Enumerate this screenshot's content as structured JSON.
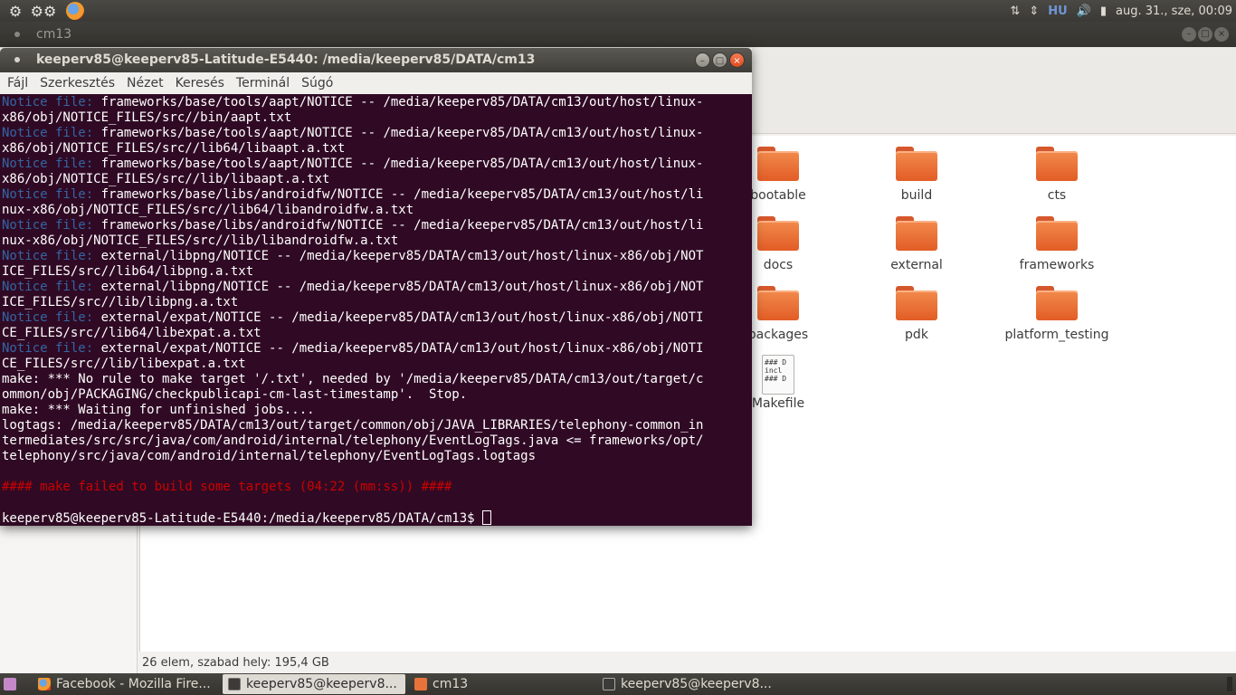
{
  "top_panel": {
    "keyboard_layout": "HU",
    "clock": "aug. 31., sze, 00:09"
  },
  "file_manager": {
    "title": "cm13",
    "status": "26 elem, szabad hely: 195,4 GB",
    "items": [
      {
        "name": "bootable",
        "type": "folder"
      },
      {
        "name": "build",
        "type": "folder"
      },
      {
        "name": "cts",
        "type": "folder"
      },
      {
        "name": "docs",
        "type": "folder"
      },
      {
        "name": "external",
        "type": "folder"
      },
      {
        "name": "frameworks",
        "type": "folder"
      },
      {
        "name": "packages",
        "type": "folder"
      },
      {
        "name": "pdk",
        "type": "folder"
      },
      {
        "name": "platform_testing",
        "type": "folder"
      },
      {
        "name": "Makefile",
        "type": "file",
        "preview": "### D\nincl\n### D"
      }
    ]
  },
  "terminal": {
    "title": "keeperv85@keeperv85-Latitude-E5440: /media/keeperv85/DATA/cm13",
    "menu": [
      "Fájl",
      "Szerkesztés",
      "Nézet",
      "Keresés",
      "Terminál",
      "Súgó"
    ],
    "lines": [
      {
        "prefix": "Notice file:",
        "text": " frameworks/base/tools/aapt/NOTICE -- /media/keeperv85/DATA/cm13/out/host/linux-"
      },
      {
        "prefix": "",
        "text": "x86/obj/NOTICE_FILES/src//bin/aapt.txt"
      },
      {
        "prefix": "Notice file:",
        "text": " frameworks/base/tools/aapt/NOTICE -- /media/keeperv85/DATA/cm13/out/host/linux-"
      },
      {
        "prefix": "",
        "text": "x86/obj/NOTICE_FILES/src//lib64/libaapt.a.txt"
      },
      {
        "prefix": "Notice file:",
        "text": " frameworks/base/tools/aapt/NOTICE -- /media/keeperv85/DATA/cm13/out/host/linux-"
      },
      {
        "prefix": "",
        "text": "x86/obj/NOTICE_FILES/src//lib/libaapt.a.txt"
      },
      {
        "prefix": "Notice file:",
        "text": " frameworks/base/libs/androidfw/NOTICE -- /media/keeperv85/DATA/cm13/out/host/li"
      },
      {
        "prefix": "",
        "text": "nux-x86/obj/NOTICE_FILES/src//lib64/libandroidfw.a.txt"
      },
      {
        "prefix": "Notice file:",
        "text": " frameworks/base/libs/androidfw/NOTICE -- /media/keeperv85/DATA/cm13/out/host/li"
      },
      {
        "prefix": "",
        "text": "nux-x86/obj/NOTICE_FILES/src//lib/libandroidfw.a.txt"
      },
      {
        "prefix": "Notice file:",
        "text": " external/libpng/NOTICE -- /media/keeperv85/DATA/cm13/out/host/linux-x86/obj/NOT"
      },
      {
        "prefix": "",
        "text": "ICE_FILES/src//lib64/libpng.a.txt"
      },
      {
        "prefix": "Notice file:",
        "text": " external/libpng/NOTICE -- /media/keeperv85/DATA/cm13/out/host/linux-x86/obj/NOT"
      },
      {
        "prefix": "",
        "text": "ICE_FILES/src//lib/libpng.a.txt"
      },
      {
        "prefix": "Notice file:",
        "text": " external/expat/NOTICE -- /media/keeperv85/DATA/cm13/out/host/linux-x86/obj/NOTI"
      },
      {
        "prefix": "",
        "text": "CE_FILES/src//lib64/libexpat.a.txt"
      },
      {
        "prefix": "Notice file:",
        "text": " external/expat/NOTICE -- /media/keeperv85/DATA/cm13/out/host/linux-x86/obj/NOTI"
      },
      {
        "prefix": "",
        "text": "CE_FILES/src//lib/libexpat.a.txt"
      },
      {
        "prefix": "",
        "text": "make: *** No rule to make target '/.txt', needed by '/media/keeperv85/DATA/cm13/out/target/c"
      },
      {
        "prefix": "",
        "text": "ommon/obj/PACKAGING/checkpublicapi-cm-last-timestamp'.  Stop."
      },
      {
        "prefix": "",
        "text": "make: *** Waiting for unfinished jobs...."
      },
      {
        "prefix": "",
        "text": "logtags: /media/keeperv85/DATA/cm13/out/target/common/obj/JAVA_LIBRARIES/telephony-common_in"
      },
      {
        "prefix": "",
        "text": "termediates/src/src/java/com/android/internal/telephony/EventLogTags.java <= frameworks/opt/"
      },
      {
        "prefix": "",
        "text": "telephony/src/java/com/android/internal/telephony/EventLogTags.logtags"
      },
      {
        "prefix": "",
        "text": ""
      },
      {
        "prefix": "",
        "text": "#### make failed to build some targets (04:22 (mm:ss)) ####",
        "red": true
      },
      {
        "prefix": "",
        "text": ""
      }
    ],
    "prompt": "keeperv85@keeperv85-Latitude-E5440:/media/keeperv85/DATA/cm13$ "
  },
  "taskbar": {
    "tasks": [
      "Facebook - Mozilla Fire...",
      "keeperv85@keeperv8...",
      "cm13",
      "keeperv85@keeperv8..."
    ]
  }
}
